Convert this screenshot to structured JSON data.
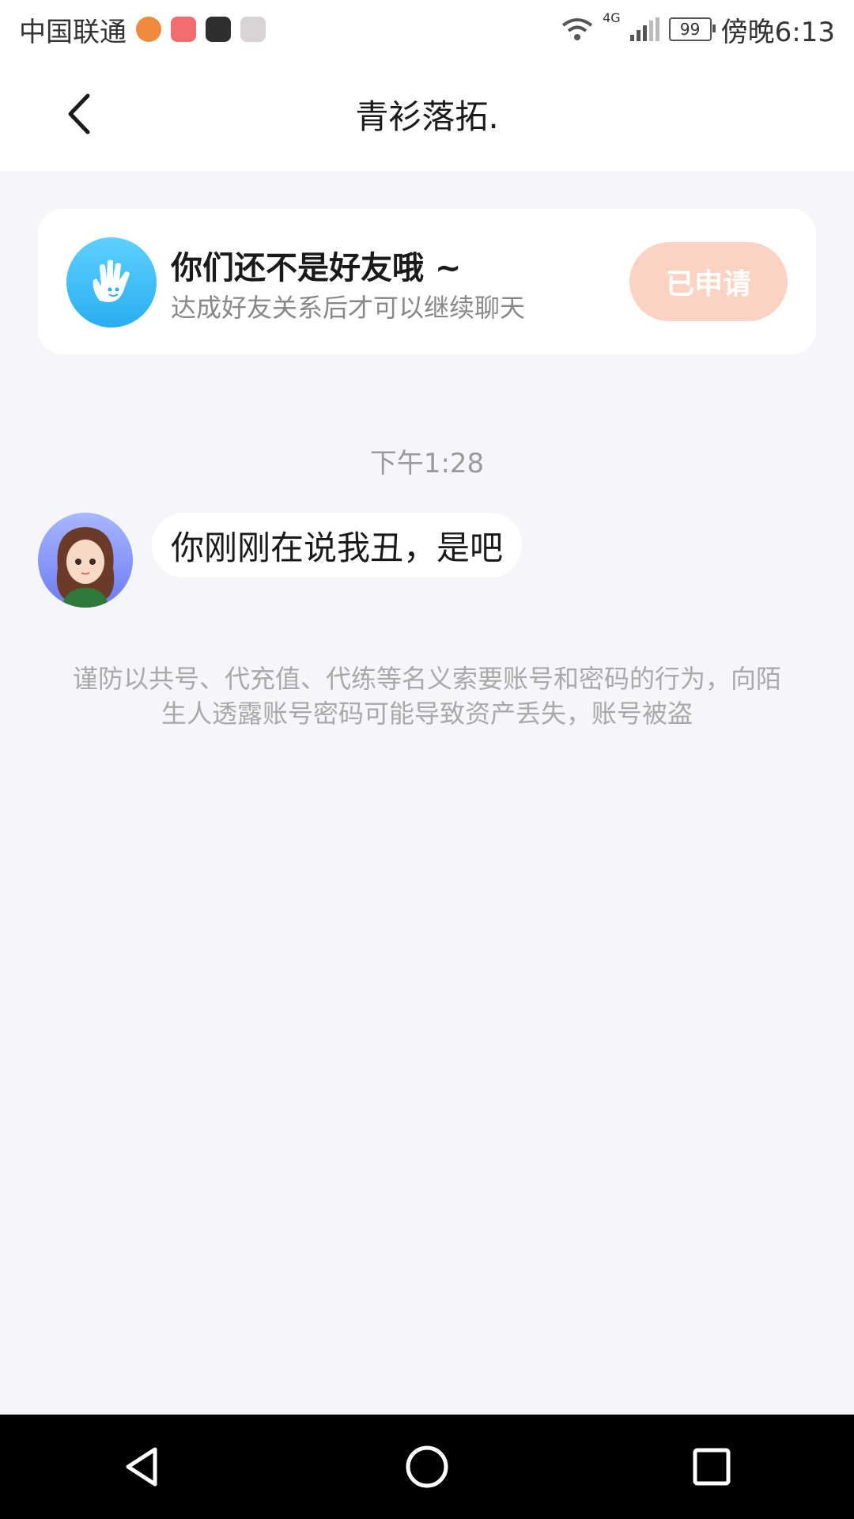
{
  "status_bar": {
    "carrier": "中国联通",
    "network": "4G",
    "battery": "99",
    "time": "傍晚6:13",
    "icons": [
      "app-icon-1",
      "app-icon-2",
      "app-icon-3",
      "app-icon-4",
      "wifi-icon",
      "signal-icon",
      "battery-icon"
    ]
  },
  "header": {
    "title": "青衫落拓."
  },
  "friend_card": {
    "title": "你们还不是好友哦 ~",
    "subtitle": "达成好友关系后才可以继续聊天",
    "button_label": "已申请"
  },
  "chat": {
    "timestamp": "下午1:28",
    "messages": [
      {
        "text": "你刚刚在说我丑，是吧"
      }
    ]
  },
  "warning": {
    "text": "谨防以共号、代充值、代练等名义索要账号和密码的行为，向陌生人透露账号密码可能导致资产丢失，账号被盗"
  },
  "colors": {
    "background": "#f4f6f9",
    "accent_button": "#fcd3c2",
    "hand_avatar": "#29aef0"
  }
}
